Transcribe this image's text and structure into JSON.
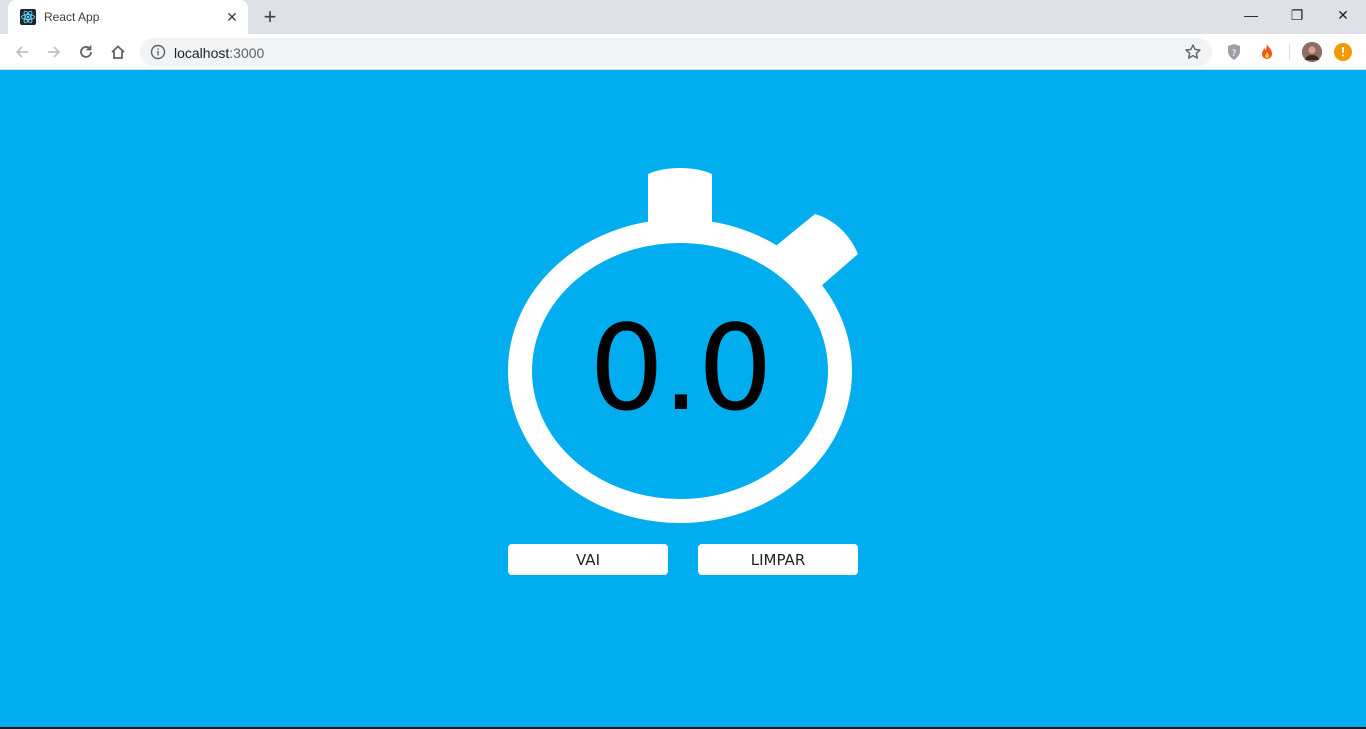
{
  "browser": {
    "tab": {
      "title": "React App",
      "favicon": "react-icon",
      "close_label": "✕"
    },
    "new_tab_label": "+",
    "window_controls": {
      "minimize": "—",
      "restore": "❐",
      "close": "✕"
    },
    "address": {
      "host": "localhost",
      "port": ":3000"
    },
    "extensions": [
      "shield-question-icon",
      "fire-icon",
      "profile-avatar",
      "update-alert-icon"
    ]
  },
  "app": {
    "background_color": "#00adef",
    "time_display": "0.0",
    "buttons": {
      "start_label": "VAI",
      "clear_label": "LIMPAR"
    }
  }
}
